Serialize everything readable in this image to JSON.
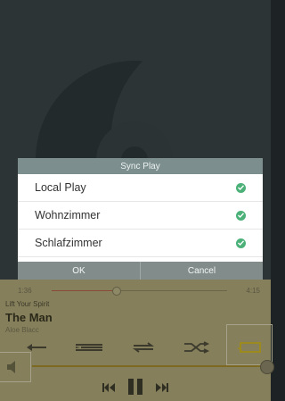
{
  "player": {
    "time_elapsed": "1:36",
    "time_total": "4:15",
    "progress_fraction": 0.37,
    "album": "Lift Your Spirit",
    "song": "The Man",
    "artist": "Aloe Blacc",
    "volume_fraction": 0.98,
    "icons": [
      "previous-icon",
      "playlist-icon",
      "repeat-icon",
      "shuffle-icon",
      "cast-icon",
      "volume-icon",
      "skip-back-icon",
      "pause-icon",
      "skip-forward-icon"
    ]
  },
  "dialog": {
    "title": "Sync Play",
    "devices": [
      {
        "label": "Local Play",
        "checked": true
      },
      {
        "label": "Wohnzimmer",
        "checked": true
      },
      {
        "label": "Schlafzimmer",
        "checked": true
      }
    ],
    "ok_label": "OK",
    "cancel_label": "Cancel"
  },
  "colors": {
    "dialog_header": "#7c8e8d",
    "check": "#4bb178",
    "player_panel": "#857f5c"
  }
}
